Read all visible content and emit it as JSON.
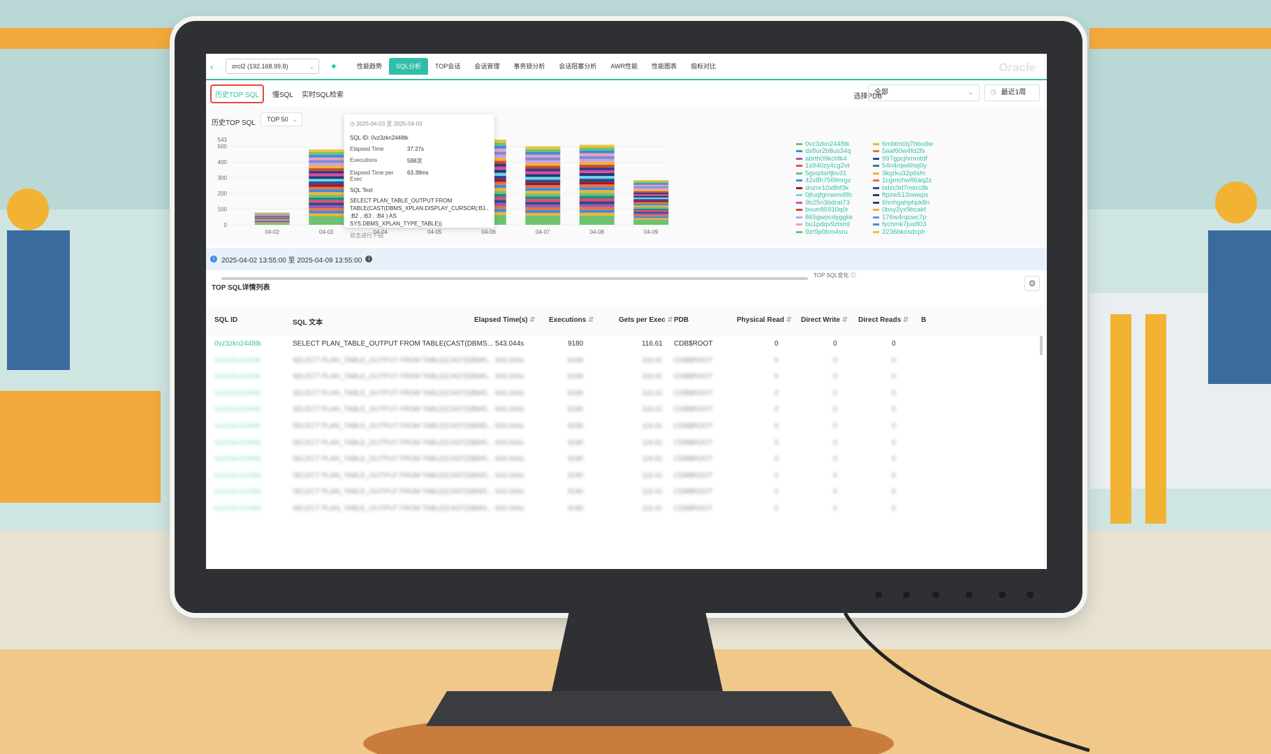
{
  "header": {
    "back_icon": "chevron-left-icon",
    "instance": "orcl2 (192.168.99.8)",
    "logo_icon": "app-logo-icon",
    "brand": "Oracle",
    "nav": [
      "性能趋势",
      "SQL分析",
      "TOP会话",
      "会话管理",
      "事务锁分析",
      "会话阻塞分析",
      "AWR性能",
      "性能图表",
      "指标对比"
    ],
    "active_nav": "SQL分析"
  },
  "subnav": {
    "tabs": [
      "历史TOP SQL",
      "慢SQL",
      "实时SQL检索"
    ],
    "active": "历史TOP SQL",
    "pdb_label": "选择PDB",
    "pdb_value": "全部",
    "range_value": "最近1周"
  },
  "chart_section": {
    "title": "历史TOP SQL",
    "topn": "TOP 50",
    "footer_label": "TOP SQL变化"
  },
  "chart_data": {
    "type": "bar",
    "stacked": true,
    "categories": [
      "04-02",
      "04-03",
      "04-04",
      "04-05",
      "04-06",
      "04-07",
      "04-08",
      "04-09"
    ],
    "totals": [
      78,
      480,
      null,
      null,
      543,
      500,
      510,
      285
    ],
    "y_ticks": [
      0,
      100,
      200,
      300,
      400,
      500,
      543
    ],
    "ylim": [
      0,
      543
    ],
    "legend_position": "right",
    "legend": [
      "0vz3zkn2448tk",
      "6mbtm0q7hbudw",
      "ds8ur2b8us34q",
      "5aaf60w4fd2fs",
      "abrth09kchfk4",
      "997gpcjhmmtdf",
      "1s940zy4cg2vt",
      "54n4rqw6hsj0y",
      "5gvq4srfjbv31",
      "3kgrku32p6sfn",
      "42x8h756fmrgz",
      "1cgmchw86aq2z",
      "dnznr10x8hf3k",
      "bdzc9d7mkrc8k",
      "0jfuqfgmwmd9h",
      "ftpzw513swwps",
      "9b25n3bdrat73",
      "6hnhgahphpk8n",
      "bvurr85910q0r",
      "0bxy2yx9bcakf",
      "865gwpcdyggkk",
      "176w4rqcwc7p",
      "bu1pdqv9ztsml",
      "fychmk7jux803",
      "9zr9p0bm4sru",
      "2236bkosdcph"
    ],
    "legend_colors": [
      "#6dc36f",
      "#f2b233",
      "#3c8ae6",
      "#e8743b",
      "#9b59b6",
      "#2c4a8c",
      "#e84a6e",
      "#1c8c8c",
      "#6dc36f",
      "#f2b233",
      "#3c8ae6",
      "#e8743b",
      "#a0182e",
      "#2c4a8c",
      "#6dd3e8",
      "#1f3b73",
      "#d94ea3",
      "#3a3a7a",
      "#c84a3a",
      "#f2b233",
      "#c8a3e8",
      "#7a8ad6",
      "#f0a0b8",
      "#3c8ae6",
      "#6dc36f",
      "#e8c43b"
    ]
  },
  "tooltip": {
    "date_range": "2025-04-03 至 2025-04-03",
    "sql_id_label": "SQL ID:",
    "sql_id": "0vz3zkn2448tk",
    "elapsed_label": "Elapsed Time",
    "elapsed": "37.27s",
    "exec_label": "Executions",
    "exec": "588次",
    "per_exec_label": "Elapsed Time per Exec",
    "per_exec": "63.38ms",
    "sql_text_label": "SQL Text",
    "sql_text": "SELECT PLAN_TABLE_OUTPUT FROM TABLE(CAST(DBMS_XPLAN.DISPLAY_CURSOR(:B1 , :B2 , :B3 , :B4 ) AS SYS.DBMS_XPLAN_TYPE_TABLE))",
    "drill_hint": "双击进行下钻"
  },
  "time_window": {
    "text": "2025-04-02 13:55:00 至 2025-04-09 13:55:00"
  },
  "table": {
    "title": "TOP SQL详情列表",
    "columns": [
      "SQL ID",
      "SQL 文本",
      "Elapsed Time(s)",
      "Executions",
      "Gets per Exec",
      "PDB",
      "Physical Read",
      "Direct Write",
      "Direct Reads",
      "B"
    ],
    "rows": [
      [
        "0vz3zkn2448tk",
        "SELECT PLAN_TABLE_OUTPUT FROM TABLE(CAST(DBMS...",
        "543.044s",
        "9180",
        "116.61",
        "CDB$ROOT",
        "0",
        "0",
        "0"
      ]
    ]
  }
}
